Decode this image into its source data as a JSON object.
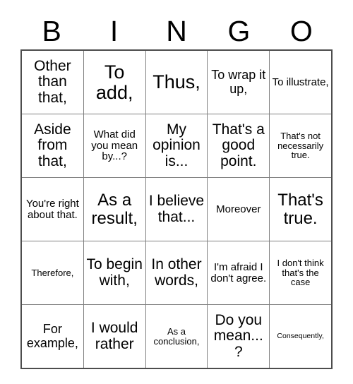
{
  "card": {
    "header": {
      "letters": [
        "B",
        "I",
        "N",
        "G",
        "O"
      ]
    },
    "rows": [
      {
        "cells": [
          {
            "text": "Other than that,",
            "size": "lg"
          },
          {
            "text": "To add,",
            "size": "xxl"
          },
          {
            "text": "Thus,",
            "size": "xxl"
          },
          {
            "text": "To wrap it up,",
            "size": "md"
          },
          {
            "text": "To illustrate,",
            "size": "sm"
          }
        ]
      },
      {
        "cells": [
          {
            "text": "Aside from that,",
            "size": "lg"
          },
          {
            "text": "What did you mean by...?",
            "size": "sm"
          },
          {
            "text": "My opinion is...",
            "size": "lg"
          },
          {
            "text": "That's a good point.",
            "size": "lg"
          },
          {
            "text": "That's not necessarily true.",
            "size": "xs"
          }
        ]
      },
      {
        "cells": [
          {
            "text": "You're right about that.",
            "size": "sm"
          },
          {
            "text": "As a result,",
            "size": "xl"
          },
          {
            "text": "I believe that...",
            "size": "lg"
          },
          {
            "text": "Moreover",
            "size": "sm"
          },
          {
            "text": "That's true.",
            "size": "xl"
          }
        ]
      },
      {
        "cells": [
          {
            "text": "Therefore,",
            "size": "xs"
          },
          {
            "text": "To begin with,",
            "size": "lg"
          },
          {
            "text": "In other words,",
            "size": "lg"
          },
          {
            "text": "I'm afraid I don't agree.",
            "size": "sm"
          },
          {
            "text": "I don't think that's the case",
            "size": "xs"
          }
        ]
      },
      {
        "cells": [
          {
            "text": "For example,",
            "size": "md"
          },
          {
            "text": "I would rather",
            "size": "lg"
          },
          {
            "text": "As a conclusion,",
            "size": "xs"
          },
          {
            "text": "Do you mean...?",
            "size": "lg"
          },
          {
            "text": "Consequently,",
            "size": "xxs"
          }
        ]
      }
    ]
  },
  "colors": {
    "background": "#ffffff",
    "text": "#000000",
    "outer_border": "#4d4d4d",
    "inner_border": "#808080"
  }
}
